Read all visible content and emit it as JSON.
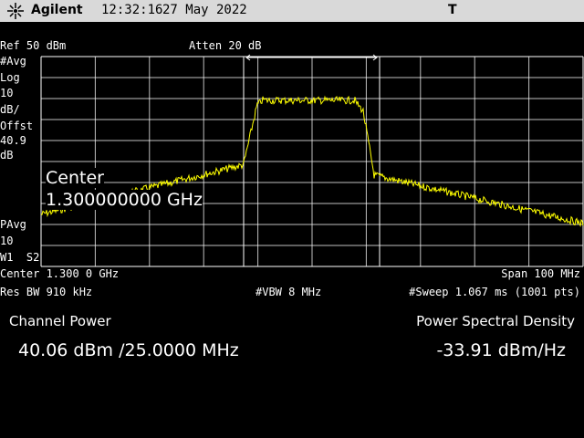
{
  "header": {
    "brand": "Agilent",
    "time": "12:32:16",
    "date": "27 May 2022",
    "trigger_indicator": "T"
  },
  "screen": {
    "ref_level": "Ref 50 dBm",
    "atten": "Atten 20 dB",
    "left_annotations": {
      "avg": "#Avg",
      "scale_type": "Log",
      "scale_value": "10",
      "scale_unit": "dB/",
      "offset_label": "Offst",
      "offset_value": "40.9",
      "offset_unit": "dB",
      "pavg": "PAvg",
      "pavg_value": "10",
      "trace_mode": "W1  S2"
    },
    "active_function": {
      "label": "Center",
      "value": "1.300000000 GHz"
    },
    "center": "Center 1.300 0 GHz",
    "span": "Span 100 MHz",
    "res_bw": "Res BW 910 kHz",
    "vbw": "#VBW 8 MHz",
    "sweep": "#Sweep 1.067 ms (1001 pts)",
    "trace_color": "#ffff00",
    "graticule_color": "#ffffff"
  },
  "results": {
    "channel_power_label": "Channel Power",
    "channel_power_value": "40.06 dBm /25.0000 MHz",
    "psd_label": "Power Spectral Density",
    "psd_value": "-33.91 dBm/Hz"
  }
}
